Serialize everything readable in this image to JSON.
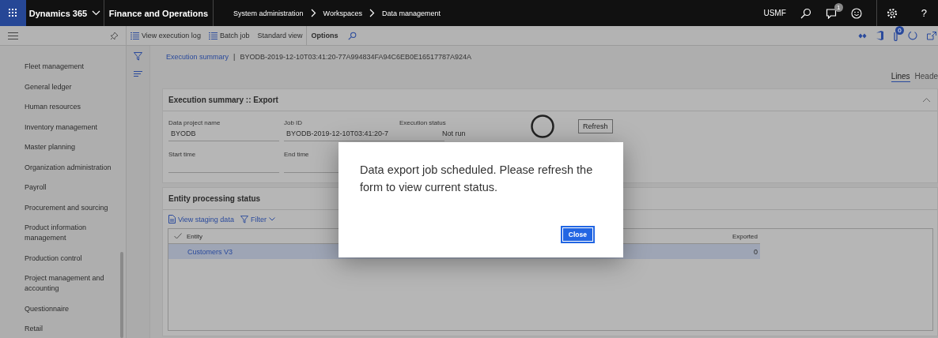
{
  "app_bar": {
    "app_name": "Dynamics 365",
    "module": "Finance and Operations",
    "breadcrumb": [
      "System administration",
      "Workspaces",
      "Data management"
    ],
    "company": "USMF",
    "notification_count": "1",
    "help_label": "?"
  },
  "toolbar": {
    "actions": [
      {
        "label": "View execution log",
        "kind": "list"
      },
      {
        "label": "Batch job",
        "kind": "list"
      },
      {
        "label": "Standard view",
        "kind": "plain"
      },
      {
        "label": "Options",
        "kind": "bold"
      }
    ],
    "attachment_count": "0"
  },
  "sidebar": {
    "items": [
      "Fleet management",
      "General ledger",
      "Human resources",
      "Inventory management",
      "Master planning",
      "Organization administration",
      "Payroll",
      "Procurement and sourcing",
      "Product information management",
      "Production control",
      "Project management and accounting",
      "Questionnaire",
      "Retail"
    ]
  },
  "page": {
    "breadcrumb_link": "Execution summary",
    "separator": "|",
    "record_id": "BYODB-2019-12-10T03:41:20-77A994834FA94C6EB0E16517787A924A",
    "view_tabs": [
      {
        "label": "Lines",
        "selected": true
      },
      {
        "label": "Heade",
        "selected": false
      }
    ]
  },
  "summary": {
    "title": "Execution summary :: Export",
    "expanded": true,
    "fields": [
      {
        "label": "Data project name",
        "value": "BYODB"
      },
      {
        "label": "Job ID",
        "value": "BYODB-2019-12-10T03:41:20-7"
      },
      {
        "label": "Execution status",
        "value": "Not run"
      },
      {
        "label": "Start time"
      },
      {
        "label": "End time"
      }
    ],
    "refresh_button": "Refresh"
  },
  "entity_status": {
    "title": "Entity processing status",
    "actions": [
      {
        "label": "View staging data",
        "kind": "document"
      },
      {
        "label": "Filter",
        "kind": "filter"
      }
    ],
    "columns": [
      "Entity",
      "Exported"
    ],
    "rows": [
      {
        "entity": "Customers V3",
        "exported": "0",
        "selected": true
      }
    ]
  },
  "dialog": {
    "message": "Data export job scheduled. Please refresh the form to view current status.",
    "button": "Close"
  }
}
